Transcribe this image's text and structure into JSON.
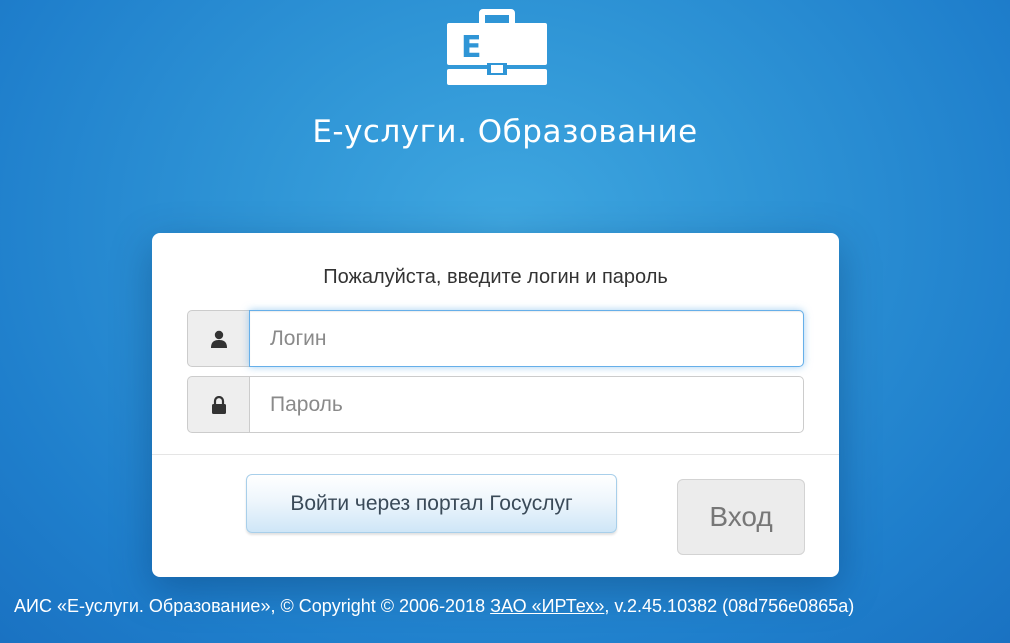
{
  "header": {
    "logo_icon": "briefcase-e-icon",
    "logo_letter": "E",
    "title": "Е-услуги. Образование"
  },
  "login": {
    "prompt": "Пожалуйста, введите логин и пароль",
    "login_icon": "user-icon",
    "login_placeholder": "Логин",
    "login_value": "",
    "password_icon": "lock-icon",
    "password_placeholder": "Пароль",
    "password_value": "",
    "gosuslugi_label": "Войти через портал Госуслуг",
    "enter_label": "Вход"
  },
  "footer": {
    "text_before": "АИС «Е-услуги. Образование», © Copyright © 2006-2018 ",
    "company_link": "ЗАО «ИРТех»",
    "text_after": ", v.2.45.10382 (08d756e0865a)"
  },
  "colors": {
    "background": "#2f95d6",
    "card": "#ffffff",
    "focus_border": "#66afe9"
  }
}
